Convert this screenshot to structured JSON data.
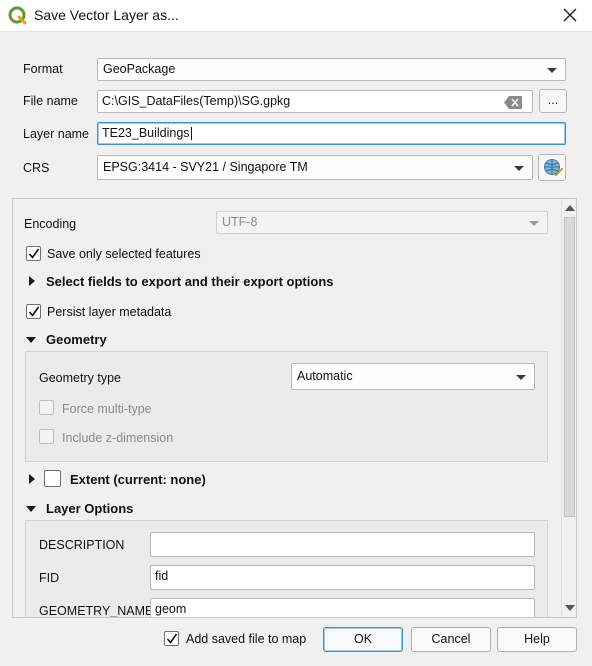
{
  "window": {
    "title": "Save Vector Layer as...",
    "app_icon": "qgis-logo-icon"
  },
  "form": {
    "format_label": "Format",
    "format_value": "GeoPackage",
    "filename_label": "File name",
    "filename_value": "C:\\GIS_DataFiles(Temp)\\SG.gpkg",
    "browse_label": "...",
    "layername_label": "Layer name",
    "layername_value": "TE23_Buildings",
    "crs_label": "CRS",
    "crs_value": "EPSG:3414 - SVY21 / Singapore TM"
  },
  "options": {
    "encoding_label": "Encoding",
    "encoding_value": "UTF-8",
    "save_selected_label": "Save only selected features",
    "save_selected_checked": true,
    "select_fields_label": "Select fields to export and their export options",
    "persist_metadata_label": "Persist layer metadata",
    "persist_metadata_checked": true,
    "geometry_section": "Geometry",
    "geometry_type_label": "Geometry type",
    "geometry_type_value": "Automatic",
    "force_multi_label": "Force multi-type",
    "include_z_label": "Include z-dimension",
    "extent_label": "Extent (current: none)",
    "layer_options_section": "Layer Options",
    "description_label": "DESCRIPTION",
    "description_value": "",
    "fid_label": "FID",
    "fid_value": "fid",
    "geometry_name_label": "GEOMETRY_NAME",
    "geometry_name_value": "geom"
  },
  "footer": {
    "add_to_map_label": "Add saved file to map",
    "add_to_map_checked": true,
    "ok_label": "OK",
    "cancel_label": "Cancel",
    "help_label": "Help"
  },
  "colors": {
    "focus_border": "#3a90d9",
    "window_bg": "#f0f0f0"
  }
}
